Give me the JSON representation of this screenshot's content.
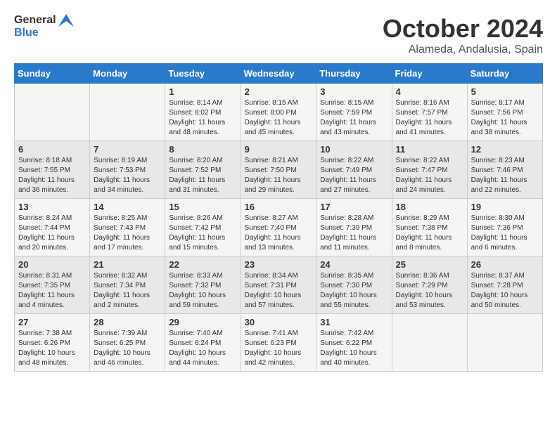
{
  "logo": {
    "general": "General",
    "blue": "Blue"
  },
  "title": "October 2024",
  "location": "Alameda, Andalusia, Spain",
  "days_header": [
    "Sunday",
    "Monday",
    "Tuesday",
    "Wednesday",
    "Thursday",
    "Friday",
    "Saturday"
  ],
  "weeks": [
    [
      {
        "day": "",
        "info": ""
      },
      {
        "day": "",
        "info": ""
      },
      {
        "day": "1",
        "sunrise": "Sunrise: 8:14 AM",
        "sunset": "Sunset: 8:02 PM",
        "daylight": "Daylight: 11 hours and 48 minutes."
      },
      {
        "day": "2",
        "sunrise": "Sunrise: 8:15 AM",
        "sunset": "Sunset: 8:00 PM",
        "daylight": "Daylight: 11 hours and 45 minutes."
      },
      {
        "day": "3",
        "sunrise": "Sunrise: 8:15 AM",
        "sunset": "Sunset: 7:59 PM",
        "daylight": "Daylight: 11 hours and 43 minutes."
      },
      {
        "day": "4",
        "sunrise": "Sunrise: 8:16 AM",
        "sunset": "Sunset: 7:57 PM",
        "daylight": "Daylight: 11 hours and 41 minutes."
      },
      {
        "day": "5",
        "sunrise": "Sunrise: 8:17 AM",
        "sunset": "Sunset: 7:56 PM",
        "daylight": "Daylight: 11 hours and 38 minutes."
      }
    ],
    [
      {
        "day": "6",
        "sunrise": "Sunrise: 8:18 AM",
        "sunset": "Sunset: 7:55 PM",
        "daylight": "Daylight: 11 hours and 36 minutes."
      },
      {
        "day": "7",
        "sunrise": "Sunrise: 8:19 AM",
        "sunset": "Sunset: 7:53 PM",
        "daylight": "Daylight: 11 hours and 34 minutes."
      },
      {
        "day": "8",
        "sunrise": "Sunrise: 8:20 AM",
        "sunset": "Sunset: 7:52 PM",
        "daylight": "Daylight: 11 hours and 31 minutes."
      },
      {
        "day": "9",
        "sunrise": "Sunrise: 8:21 AM",
        "sunset": "Sunset: 7:50 PM",
        "daylight": "Daylight: 11 hours and 29 minutes."
      },
      {
        "day": "10",
        "sunrise": "Sunrise: 8:22 AM",
        "sunset": "Sunset: 7:49 PM",
        "daylight": "Daylight: 11 hours and 27 minutes."
      },
      {
        "day": "11",
        "sunrise": "Sunrise: 8:22 AM",
        "sunset": "Sunset: 7:47 PM",
        "daylight": "Daylight: 11 hours and 24 minutes."
      },
      {
        "day": "12",
        "sunrise": "Sunrise: 8:23 AM",
        "sunset": "Sunset: 7:46 PM",
        "daylight": "Daylight: 11 hours and 22 minutes."
      }
    ],
    [
      {
        "day": "13",
        "sunrise": "Sunrise: 8:24 AM",
        "sunset": "Sunset: 7:44 PM",
        "daylight": "Daylight: 11 hours and 20 minutes."
      },
      {
        "day": "14",
        "sunrise": "Sunrise: 8:25 AM",
        "sunset": "Sunset: 7:43 PM",
        "daylight": "Daylight: 11 hours and 17 minutes."
      },
      {
        "day": "15",
        "sunrise": "Sunrise: 8:26 AM",
        "sunset": "Sunset: 7:42 PM",
        "daylight": "Daylight: 11 hours and 15 minutes."
      },
      {
        "day": "16",
        "sunrise": "Sunrise: 8:27 AM",
        "sunset": "Sunset: 7:40 PM",
        "daylight": "Daylight: 11 hours and 13 minutes."
      },
      {
        "day": "17",
        "sunrise": "Sunrise: 8:28 AM",
        "sunset": "Sunset: 7:39 PM",
        "daylight": "Daylight: 11 hours and 11 minutes."
      },
      {
        "day": "18",
        "sunrise": "Sunrise: 8:29 AM",
        "sunset": "Sunset: 7:38 PM",
        "daylight": "Daylight: 11 hours and 8 minutes."
      },
      {
        "day": "19",
        "sunrise": "Sunrise: 8:30 AM",
        "sunset": "Sunset: 7:36 PM",
        "daylight": "Daylight: 11 hours and 6 minutes."
      }
    ],
    [
      {
        "day": "20",
        "sunrise": "Sunrise: 8:31 AM",
        "sunset": "Sunset: 7:35 PM",
        "daylight": "Daylight: 11 hours and 4 minutes."
      },
      {
        "day": "21",
        "sunrise": "Sunrise: 8:32 AM",
        "sunset": "Sunset: 7:34 PM",
        "daylight": "Daylight: 11 hours and 2 minutes."
      },
      {
        "day": "22",
        "sunrise": "Sunrise: 8:33 AM",
        "sunset": "Sunset: 7:32 PM",
        "daylight": "Daylight: 10 hours and 59 minutes."
      },
      {
        "day": "23",
        "sunrise": "Sunrise: 8:34 AM",
        "sunset": "Sunset: 7:31 PM",
        "daylight": "Daylight: 10 hours and 57 minutes."
      },
      {
        "day": "24",
        "sunrise": "Sunrise: 8:35 AM",
        "sunset": "Sunset: 7:30 PM",
        "daylight": "Daylight: 10 hours and 55 minutes."
      },
      {
        "day": "25",
        "sunrise": "Sunrise: 8:36 AM",
        "sunset": "Sunset: 7:29 PM",
        "daylight": "Daylight: 10 hours and 53 minutes."
      },
      {
        "day": "26",
        "sunrise": "Sunrise: 8:37 AM",
        "sunset": "Sunset: 7:28 PM",
        "daylight": "Daylight: 10 hours and 50 minutes."
      }
    ],
    [
      {
        "day": "27",
        "sunrise": "Sunrise: 7:38 AM",
        "sunset": "Sunset: 6:26 PM",
        "daylight": "Daylight: 10 hours and 48 minutes."
      },
      {
        "day": "28",
        "sunrise": "Sunrise: 7:39 AM",
        "sunset": "Sunset: 6:25 PM",
        "daylight": "Daylight: 10 hours and 46 minutes."
      },
      {
        "day": "29",
        "sunrise": "Sunrise: 7:40 AM",
        "sunset": "Sunset: 6:24 PM",
        "daylight": "Daylight: 10 hours and 44 minutes."
      },
      {
        "day": "30",
        "sunrise": "Sunrise: 7:41 AM",
        "sunset": "Sunset: 6:23 PM",
        "daylight": "Daylight: 10 hours and 42 minutes."
      },
      {
        "day": "31",
        "sunrise": "Sunrise: 7:42 AM",
        "sunset": "Sunset: 6:22 PM",
        "daylight": "Daylight: 10 hours and 40 minutes."
      },
      {
        "day": "",
        "info": ""
      },
      {
        "day": "",
        "info": ""
      }
    ]
  ]
}
